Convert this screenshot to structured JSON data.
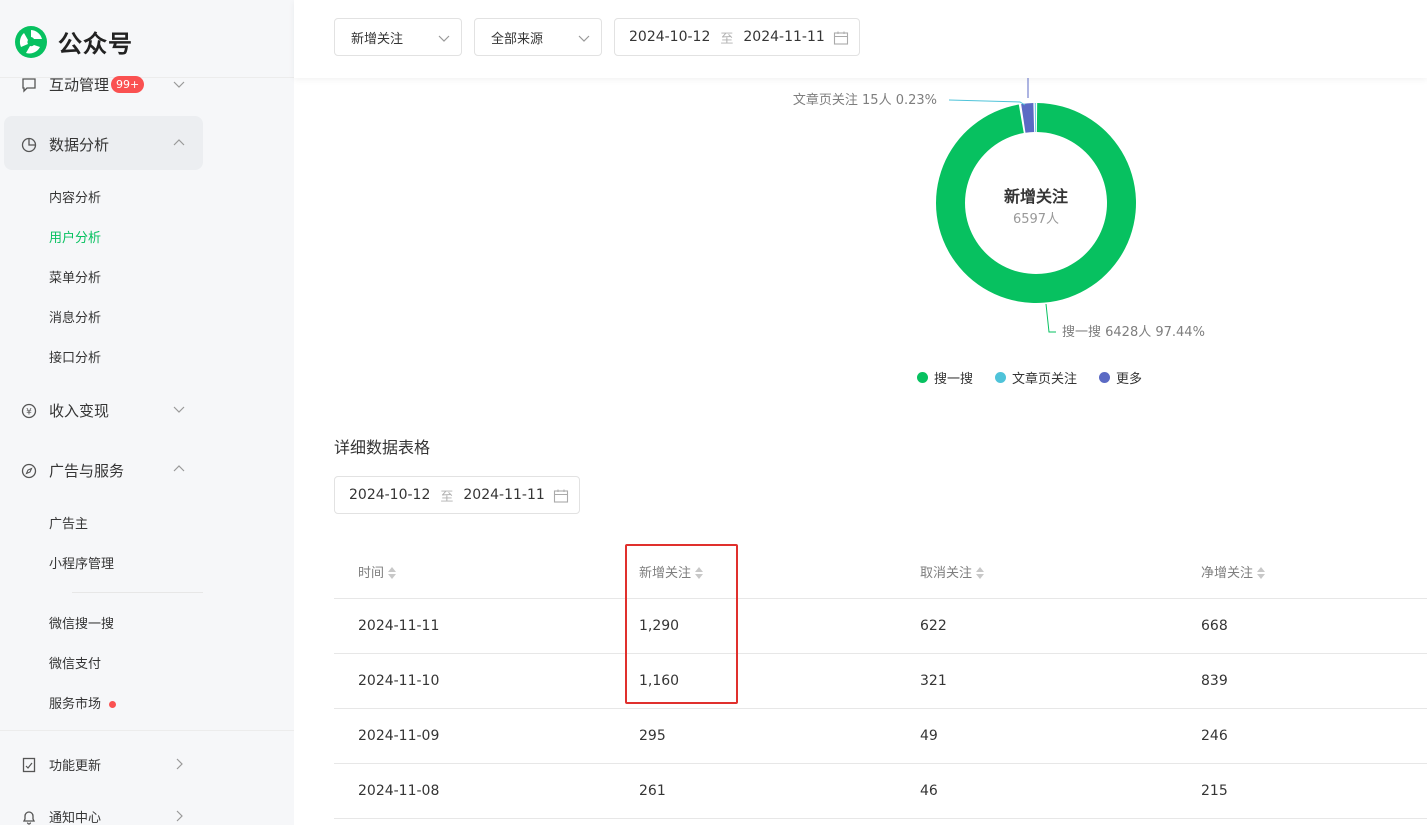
{
  "app": {
    "title": "公众号"
  },
  "sidebar": {
    "interaction": {
      "label": "互动管理",
      "badge": "99+"
    },
    "analytics": {
      "label": "数据分析",
      "items": [
        "内容分析",
        "用户分析",
        "菜单分析",
        "消息分析",
        "接口分析"
      ],
      "active_item": "用户分析"
    },
    "monetize": {
      "label": "收入变现"
    },
    "ads": {
      "label": "广告与服务",
      "items": [
        "广告主",
        "小程序管理",
        "微信搜一搜",
        "微信支付",
        "服务市场"
      ]
    },
    "updates": {
      "label": "功能更新"
    },
    "notify": {
      "label": "通知中心"
    }
  },
  "filters": {
    "type": "新增关注",
    "source": "全部来源",
    "date_start": "2024-10-12",
    "date_sep": "至",
    "date_end": "2024-11-11"
  },
  "chart_data": {
    "type": "pie",
    "center_title": "新增关注",
    "center_value": "6597人",
    "slices": [
      {
        "name": "搜一搜",
        "label": "搜一搜 6428人 97.44%",
        "value": 6428,
        "percent": 97.44,
        "color": "#07c160"
      },
      {
        "name": "文章页关注",
        "label": "文章页关注 15人 0.23%",
        "value": 15,
        "percent": 0.23,
        "color": "#4fc3d9"
      },
      {
        "name": "更多",
        "value": 154,
        "percent": 2.33,
        "color": "#5b6ac4"
      }
    ],
    "legend_position": "bottom"
  },
  "table_section": {
    "title": "详细数据表格",
    "date_start": "2024-10-12",
    "date_sep": "至",
    "date_end": "2024-11-11",
    "headers": [
      "时间",
      "新增关注",
      "取消关注",
      "净增关注"
    ],
    "rows": [
      [
        "2024-11-11",
        "1,290",
        "622",
        "668"
      ],
      [
        "2024-11-10",
        "1,160",
        "321",
        "839"
      ],
      [
        "2024-11-09",
        "295",
        "49",
        "246"
      ],
      [
        "2024-11-08",
        "261",
        "46",
        "215"
      ]
    ]
  },
  "colors": {
    "accent": "#07c160",
    "highlight_box": "#e0302d",
    "badge": "#fa5151"
  }
}
